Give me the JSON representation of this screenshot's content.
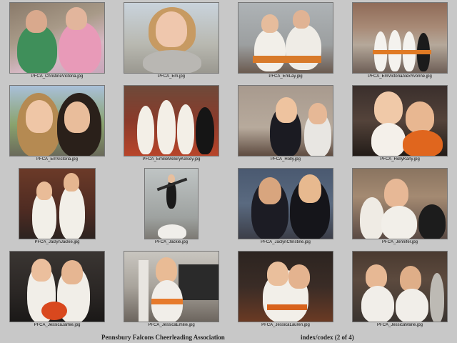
{
  "footer": {
    "title": "Pennsbury Falcons Cheerleading Association",
    "index": "index/codex (2 of 4)"
  },
  "thumbnails": [
    {
      "caption": "PFCA_ChristineVictoria.jpg"
    },
    {
      "caption": "PFCA_Em.jpg"
    },
    {
      "caption": "PFCA_EmLay.jpg"
    },
    {
      "caption": "PFCA_EmVictoriaAlexYvonne.jpg"
    },
    {
      "caption": "PFCA_EmVictoria.jpg"
    },
    {
      "caption": "PFCA_EmilieMeloryKelsey.jpg"
    },
    {
      "caption": "PFCA_Holly.jpg"
    },
    {
      "caption": "PFCA_HollyKarly.jpg"
    },
    {
      "caption": "PFCA_JaclynJackie.jpg"
    },
    {
      "caption": "PFCA_Jackie.jpg"
    },
    {
      "caption": "PFCA_JaclynChristine.jpg"
    },
    {
      "caption": "PFCA_Jennifer.jpg"
    },
    {
      "caption": "PFCA_JessicaJamie.jpg"
    },
    {
      "caption": "PFCA_JessicaEmilie.jpg"
    },
    {
      "caption": "PFCA_JessicaLauren.jpg"
    },
    {
      "caption": "PFCA_JessicaMarie.jpg"
    }
  ]
}
